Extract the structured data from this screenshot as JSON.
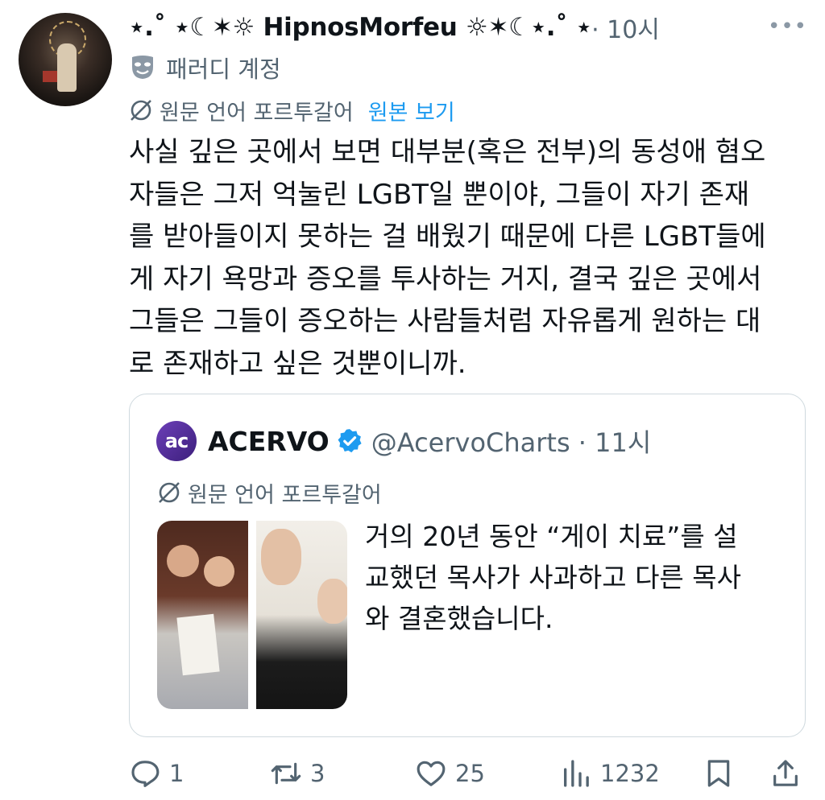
{
  "tweet": {
    "author_name": "⋆.˚ ⋆☾✶☼ HipnosMorfeu ☼✶☾⋆.˚ ⋆",
    "time": " · 10시",
    "more_label": "•••",
    "parody_label": "패러디 계정",
    "translated_from": "원문 언어 포르투갈어",
    "view_original": "원본 보기",
    "body": "사실 깊은 곳에서 보면 대부분(혹은 전부)의 동성애 혐오\n자들은 그저 억눌린 LGBT일 뿐이야, 그들이 자기 존재\n를 받아들이지 못하는 걸 배웠기 때문에 다른 LGBT들에\n게 자기 욕망과 증오를 투사하는 거지, 결국 깊은 곳에서\n그들은 그들이 증오하는 사람들처럼 자유롭게 원하는 대\n로 존재하고 싶은 것뿐이니까."
  },
  "quote": {
    "logo_text": "ac",
    "name": "ACERVO",
    "handle_time": "@AcervoCharts · 11시",
    "translated_from": "원문 언어 포르투갈어",
    "text": "거의 20년 동안 “게이 치료”를 설\n교했던 목사가 사과하고 다른 목사\n와 결혼했습니다."
  },
  "actions": {
    "replies": "1",
    "reposts": "3",
    "likes": "25",
    "views": "1232"
  },
  "icons": {
    "avatar": "avatar-image",
    "parody": "mask-icon",
    "translate": "globe-slash-icon",
    "verified": "verified-badge-icon",
    "reply": "reply-icon",
    "repost": "repost-icon",
    "like": "heart-icon",
    "views": "views-icon",
    "bookmark": "bookmark-icon",
    "share": "share-icon"
  },
  "colors": {
    "link": "#1d9bf0",
    "secondary_text": "#536471",
    "verified": "#1d9bf0",
    "border": "#cfd9de"
  }
}
